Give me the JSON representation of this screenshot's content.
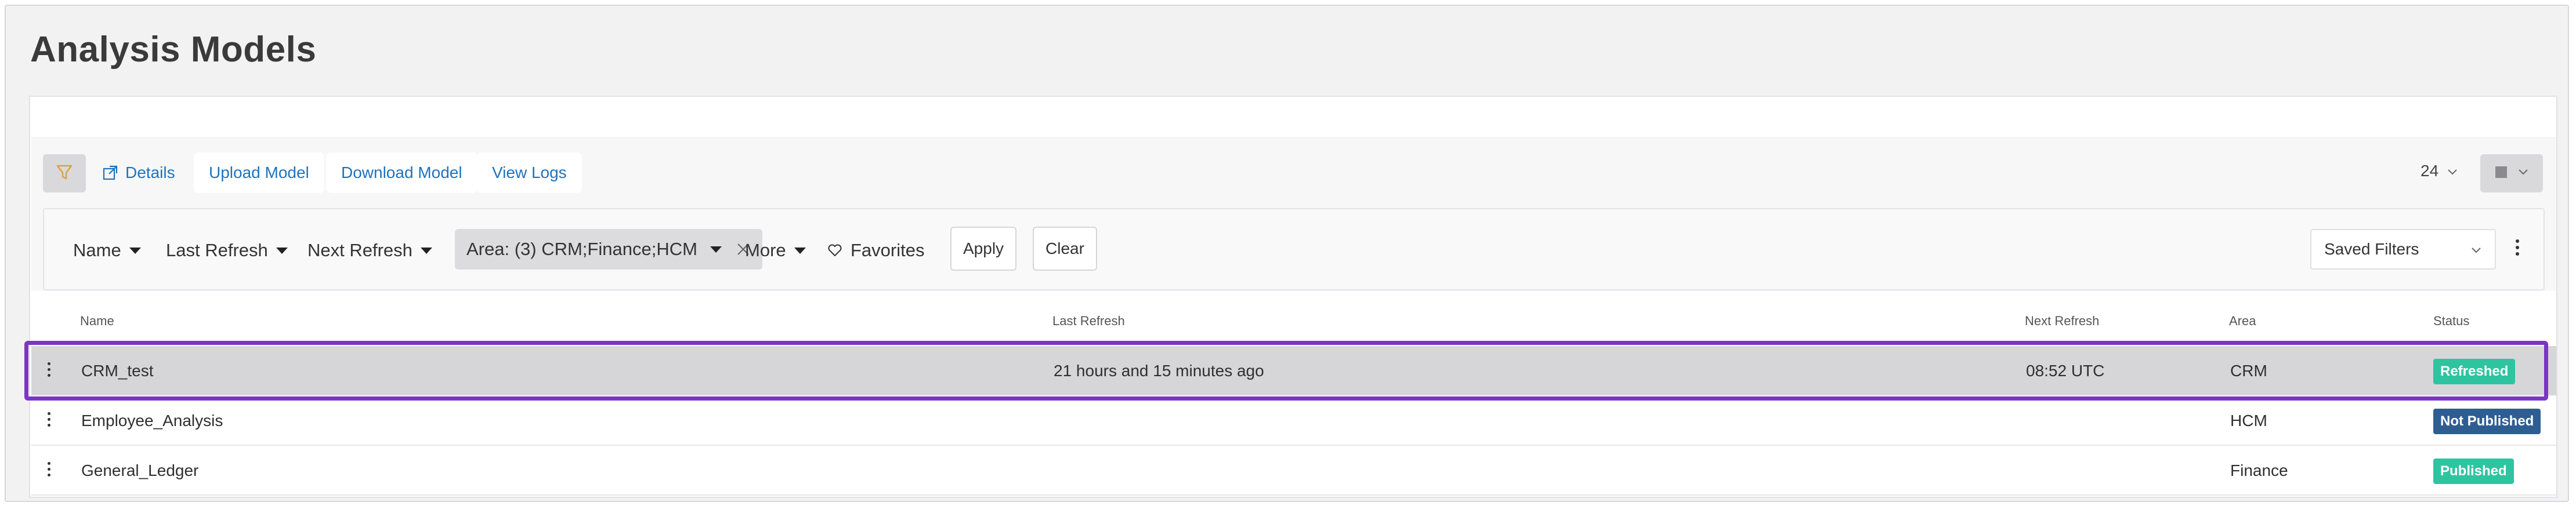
{
  "page": {
    "title": "Analysis Models"
  },
  "toolbar": {
    "details_label": "Details",
    "upload_label": "Upload Model",
    "download_label": "Download Model",
    "view_logs_label": "View Logs",
    "page_size": "24"
  },
  "filters": {
    "name_label": "Name",
    "last_refresh_label": "Last Refresh",
    "next_refresh_label": "Next Refresh",
    "area_chip_label": "Area: (3) CRM;Finance;HCM",
    "more_label": "More",
    "favorites_label": "Favorites",
    "apply_label": "Apply",
    "clear_label": "Clear",
    "saved_filters_label": "Saved Filters"
  },
  "table": {
    "columns": {
      "name": "Name",
      "last_refresh": "Last Refresh",
      "next_refresh": "Next Refresh",
      "area": "Area",
      "status": "Status"
    },
    "rows": [
      {
        "name": "CRM_test",
        "last_refresh": "21 hours and 15 minutes ago",
        "next_refresh": "08:52 UTC",
        "area": "CRM",
        "status": "Refreshed",
        "status_color": "#2ec4a0"
      },
      {
        "name": "Employee_Analysis",
        "last_refresh": "",
        "next_refresh": "",
        "area": "HCM",
        "status": "Not Published",
        "status_color": "#2e5d92"
      },
      {
        "name": "General_Ledger",
        "last_refresh": "",
        "next_refresh": "",
        "area": "Finance",
        "status": "Published",
        "status_color": "#2ec4a0"
      }
    ]
  },
  "colors": {
    "accent_link": "#1e73be",
    "selection_outline": "#7b35c6",
    "filter_icon": "#d9a441"
  },
  "icons": {
    "filter": "filter-icon",
    "details": "external-link-icon",
    "page_size_chevron": "chevron-down-icon",
    "view": "grid-view-icon",
    "favorites": "heart-icon",
    "remove_filter": "close-icon",
    "row_menu": "kebab-icon"
  }
}
